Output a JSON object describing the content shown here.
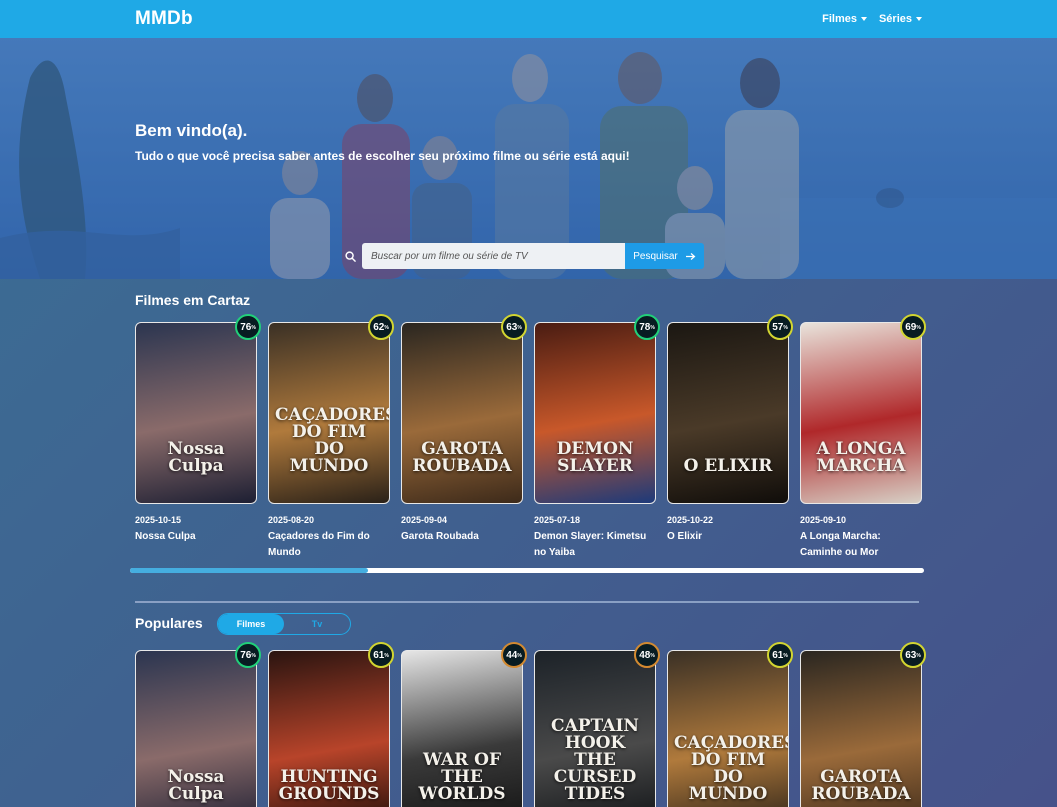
{
  "navbar": {
    "brand": "MMDb",
    "menu": [
      {
        "label": "Filmes"
      },
      {
        "label": "Séries"
      }
    ]
  },
  "hero": {
    "title": "Bem vindo(a).",
    "subtitle": "Tudo o que você precisa saber antes de escolher seu próximo filme ou série está aqui!",
    "search": {
      "placeholder": "Buscar por um filme ou série de TV",
      "button_label": "Pesquisar"
    }
  },
  "now_playing": {
    "title": "Filmes em Cartaz",
    "scroll_position": 0.3,
    "movies": [
      {
        "poster_text": "Nossa Culpa",
        "score": "76",
        "date": "2025-10-15",
        "title": "Nossa Culpa",
        "colors": [
          "#2b3550",
          "#8a6b6a",
          "#1d1f33"
        ],
        "ring": "#21d07a"
      },
      {
        "poster_text": "CAÇADORES DO FIM DO MUNDO",
        "score": "62",
        "date": "2025-08-20",
        "title": "Caçadores do Fim do Mundo",
        "colors": [
          "#3a3025",
          "#b07a3c",
          "#2a2118"
        ],
        "ring": "#d2d531"
      },
      {
        "poster_text": "GAROTA ROUBADA",
        "score": "63",
        "date": "2025-09-04",
        "title": "Garota Roubada",
        "colors": [
          "#2a2620",
          "#9a6a3a",
          "#3d2a1a"
        ],
        "ring": "#d2d531"
      },
      {
        "poster_text": "DEMON SLAYER",
        "score": "78",
        "date": "2025-07-18",
        "title": "Demon Slayer: Kimetsu no Yaiba",
        "colors": [
          "#4a1c12",
          "#c8582a",
          "#1d3a7a"
        ],
        "ring": "#21d07a"
      },
      {
        "poster_text": "O ELIXIR",
        "score": "57",
        "date": "2025-10-22",
        "title": "O Elixir",
        "colors": [
          "#1b1712",
          "#4a3a28",
          "#100d0a"
        ],
        "ring": "#d2d531"
      },
      {
        "poster_text": "A LONGA MARCHA",
        "score": "69",
        "date": "2025-09-10",
        "title": "A Longa Marcha: Caminhe ou Mor",
        "colors": [
          "#e9e4dc",
          "#b0282a",
          "#d7d0c6"
        ],
        "ring": "#d2d531"
      }
    ]
  },
  "popular": {
    "title": "Populares",
    "toggle": {
      "active": "Filmes",
      "inactive": "Tv"
    },
    "movies": [
      {
        "poster_text": "Nossa Culpa",
        "score": "76",
        "colors": [
          "#2b3550",
          "#8a6b6a",
          "#1d1f33"
        ],
        "ring": "#21d07a"
      },
      {
        "poster_text": "HUNTING GROUNDS",
        "score": "61",
        "colors": [
          "#2a1410",
          "#b8442a",
          "#1a0c08"
        ],
        "ring": "#d2d531"
      },
      {
        "poster_text": "WAR OF THE WORLDS",
        "score": "44",
        "colors": [
          "#e6e6e6",
          "#3a3a3a",
          "#111111"
        ],
        "ring": "#d28a31"
      },
      {
        "poster_text": "CAPTAIN HOOK THE CURSED TIDES",
        "score": "48",
        "colors": [
          "#1c2228",
          "#4a4a4a",
          "#0e1114"
        ],
        "ring": "#d28a31"
      },
      {
        "poster_text": "CAÇADORES DO FIM DO MUNDO",
        "score": "61",
        "colors": [
          "#3a3025",
          "#b07a3c",
          "#2a2118"
        ],
        "ring": "#d2d531"
      },
      {
        "poster_text": "GAROTA ROUBADA",
        "score": "63",
        "colors": [
          "#2a2620",
          "#9a6a3a",
          "#3d2a1a"
        ],
        "ring": "#d2d531"
      }
    ]
  }
}
